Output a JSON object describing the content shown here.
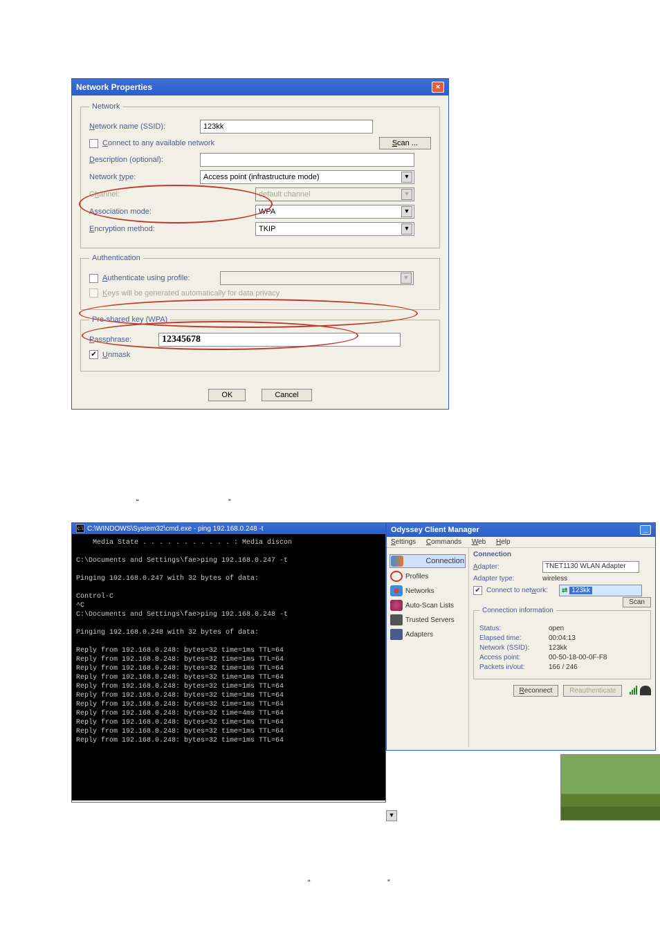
{
  "dialog": {
    "title": "Network Properties",
    "network": {
      "legend": "Network",
      "ssid_label": "Network name (SSID):",
      "ssid_value": "123kk",
      "connect_any": "Connect to any available network",
      "scan": "Scan ...",
      "desc_label": "Description (optional):",
      "desc_value": "",
      "nettype_label": "Network type:",
      "nettype_value": "Access point (infrastructure mode)",
      "channel_label": "Channel:",
      "channel_value": "default channel",
      "assoc_label": "Association mode:",
      "assoc_value": "WPA",
      "enc_label": "Encryption method:",
      "enc_value": "TKIP"
    },
    "auth": {
      "legend": "Authentication",
      "profile_label": "Authenticate using profile:",
      "keys_label": "Keys will be generated automatically for data privacy"
    },
    "psk": {
      "legend": "Pre-shared key (WPA)",
      "pass_label": "Passphrase:",
      "pass_value": "12345678",
      "unmask": "Unmask"
    },
    "ok": "OK",
    "cancel": "Cancel"
  },
  "cmd": {
    "title": "C:\\WINDOWS\\System32\\cmd.exe - ping 192.168.0.248 -t",
    "body": "    Media State . . . . . . . . . . . : Media discon\n\nC:\\Documents and Settings\\fae>ping 192.168.0.247 -t\n\nPinging 192.168.0.247 with 32 bytes of data:\n\nControl-C\n^C\nC:\\Documents and Settings\\fae>ping 192.168.0.248 -t\n\nPinging 192.168.0.248 with 32 bytes of data:\n\nReply from 192.168.0.248: bytes=32 time=1ms TTL=64\nReply from 192.168.0.248: bytes=32 time=1ms TTL=64\nReply from 192.168.0.248: bytes=32 time=1ms TTL=64\nReply from 192.168.0.248: bytes=32 time=1ms TTL=64\nReply from 192.168.0.248: bytes=32 time=1ms TTL=64\nReply from 192.168.0.248: bytes=32 time=1ms TTL=64\nReply from 192.168.0.248: bytes=32 time=1ms TTL=64\nReply from 192.168.0.248: bytes=32 time=4ms TTL=64\nReply from 192.168.0.248: bytes=32 time=1ms TTL=64\nReply from 192.168.0.248: bytes=32 time=1ms TTL=64\nReply from 192.168.0.248: bytes=32 time=1ms TTL=64"
  },
  "odyssey": {
    "title": "Odyssey Client Manager",
    "menu": {
      "settings": "Settings",
      "commands": "Commands",
      "web": "Web",
      "help": "Help"
    },
    "side": {
      "connection": "Connection",
      "profiles": "Profiles",
      "networks": "Networks",
      "autoscan": "Auto-Scan Lists",
      "trusted": "Trusted Servers",
      "adapters": "Adapters"
    },
    "panel": {
      "heading": "Connection",
      "adapter_label": "Adapter:",
      "adapter_value": "TNET1130 WLAN Adapter",
      "adaptertype_label": "Adapter type:",
      "adaptertype_value": "wireless",
      "connect_label": "Connect to network:",
      "network_value": "123kk",
      "scan": "Scan",
      "info_legend": "Connection information",
      "status_k": "Status:",
      "status_v": "open",
      "elapsed_k": "Elapsed time:",
      "elapsed_v": "00:04:13",
      "ssid_k": "Network (SSID):",
      "ssid_v": "123kk",
      "ap_k": "Access point:",
      "ap_v": "00-50-18-00-0F-F8",
      "pkt_k": "Packets in/out:",
      "pkt_v": "166 / 246",
      "reconnect": "Reconnect",
      "reauth": "Reauthenticate"
    }
  }
}
